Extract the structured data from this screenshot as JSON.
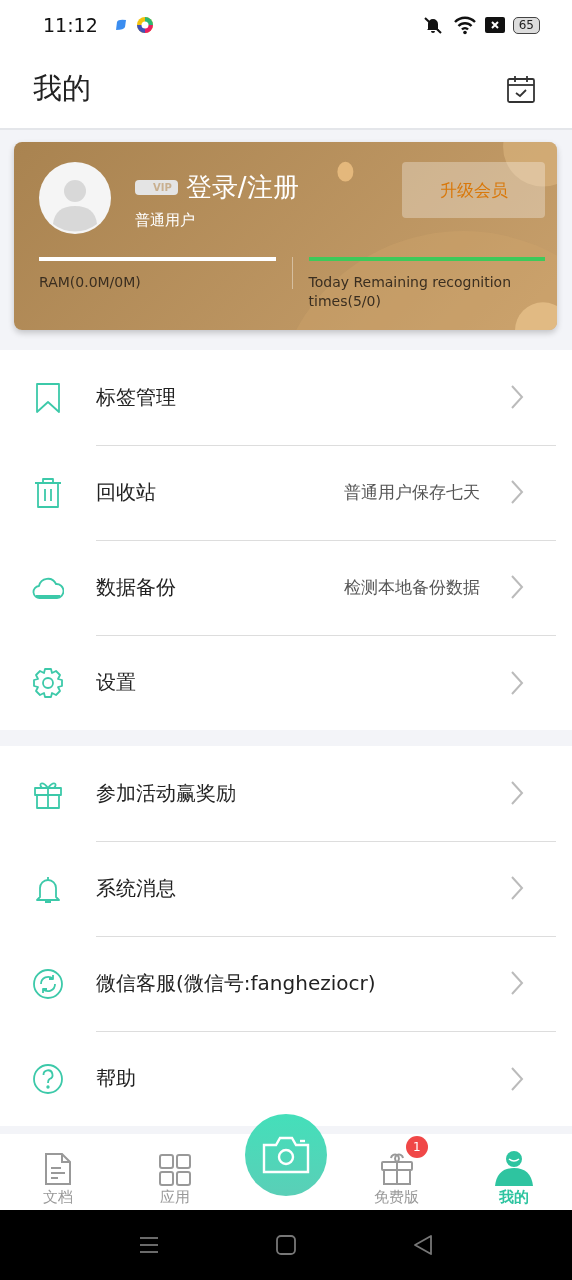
{
  "status_bar": {
    "time": "11:12",
    "battery": "65"
  },
  "header": {
    "title": "我的"
  },
  "profile": {
    "badge": "VIP",
    "login": "登录/注册",
    "user_type": "普通用户",
    "upgrade_button": "升级会员",
    "storage": {
      "label": "RAM(0.0M/0M)",
      "level": 1
    },
    "recognition": {
      "label": "Today Remaining recognition times(5/0)",
      "level": 1
    }
  },
  "menu_groups": [
    {
      "items": [
        {
          "label": "标签管理"
        },
        {
          "label": "回收站",
          "detail": "普通用户保存七天"
        },
        {
          "label": "数据备份",
          "detail": "检测本地备份数据"
        },
        {
          "label": "设置"
        }
      ]
    },
    {
      "items": [
        {
          "label": "参加活动赢奖励"
        },
        {
          "label": "系统消息"
        },
        {
          "label": "微信客服(微信号:fangheziocr)"
        },
        {
          "label": "帮助"
        }
      ]
    }
  ],
  "tabs": [
    {
      "kind": "icon",
      "label": "文档",
      "selected": false
    },
    {
      "kind": "icon",
      "label": "应用",
      "selected": false
    },
    {
      "kind": "camera",
      "selected": false
    },
    {
      "kind": "icon",
      "label": "免费版",
      "badge": "1",
      "selected": false
    },
    {
      "kind": "icon",
      "label": "我的",
      "selected": true
    }
  ]
}
